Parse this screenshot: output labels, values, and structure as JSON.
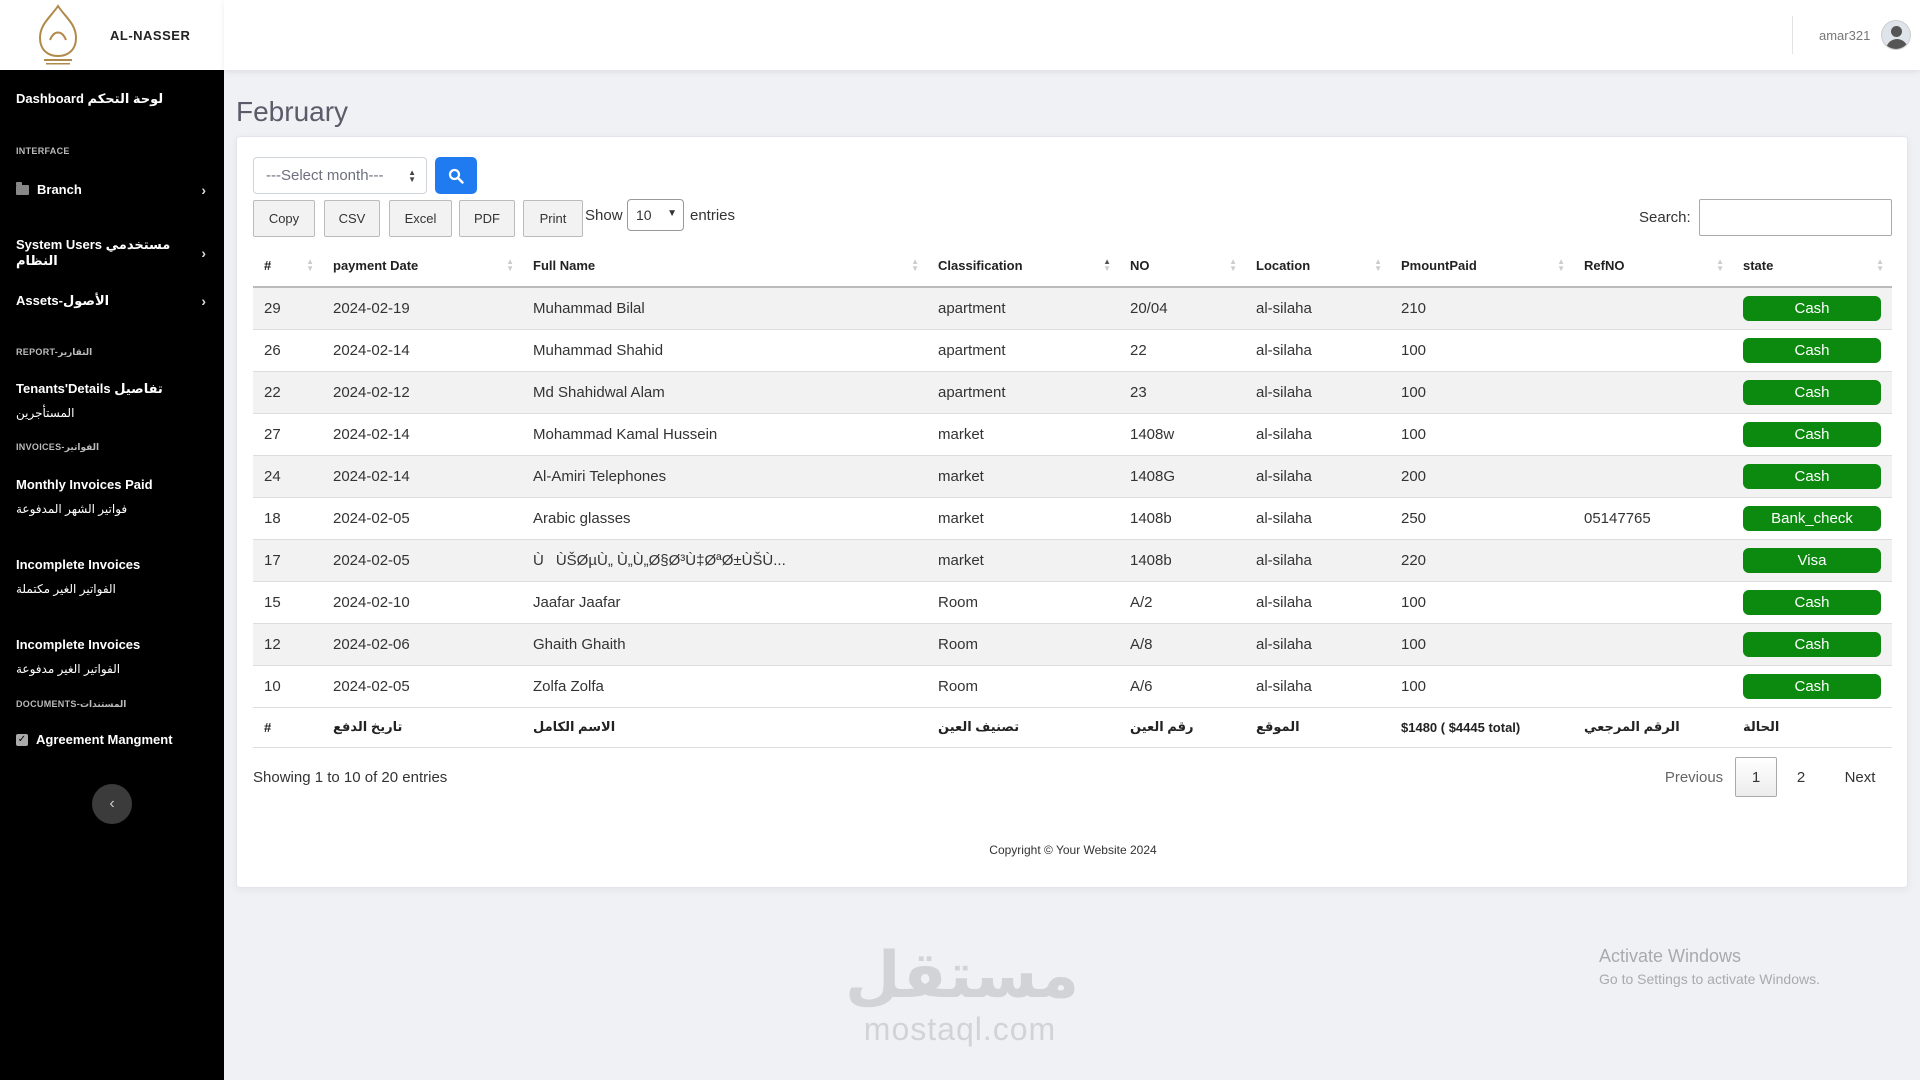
{
  "brand": {
    "name": "AL-NASSER"
  },
  "sidebar": {
    "dashboard": "Dashboard لوحة التحكم",
    "interface_heading": "INTERFACE",
    "branch": "Branch",
    "system_users": "System Users مستخدمي النظام",
    "assets": "Assets-الأصول",
    "report_heading": "REPORT-التقارير",
    "tenants_line1": "Tenants'Details تفاصيل",
    "tenants_line2": "المستأجرين",
    "invoices_heading": "INVOICES-الفواتير",
    "monthly_line1": "Monthly Invoices Paid",
    "monthly_line2": "فواتير الشهر المدفوعة",
    "incomplete1_line1": "Incomplete Invoices",
    "incomplete1_line2": "الفواتير الغير مكتملة",
    "incomplete2_line1": "Incomplete Invoices",
    "incomplete2_line2": "الفواتير الغير مدفوعة",
    "documents_heading": "DOCUMENTS-المستندات",
    "agreement": "Agreement Mangment"
  },
  "topbar": {
    "username": "amar321"
  },
  "page": {
    "title": "February"
  },
  "filter": {
    "month_placeholder": "---Select month---"
  },
  "buttons": {
    "copy": "Copy",
    "csv": "CSV",
    "excel": "Excel",
    "pdf": "PDF",
    "print": "Print"
  },
  "length": {
    "show": "Show",
    "value": "10",
    "entries": "entries"
  },
  "search": {
    "label": "Search:",
    "value": ""
  },
  "table": {
    "headers": [
      "#",
      "payment Date",
      "Full Name",
      "Classification",
      "NO",
      "Location",
      "PmountPaid",
      "RefNO",
      "state"
    ],
    "rows": [
      [
        "29",
        "2024-02-19",
        "Muhammad Bilal",
        "apartment",
        "20/04",
        "al-silaha",
        "210",
        "",
        "Cash"
      ],
      [
        "26",
        "2024-02-14",
        "Muhammad Shahid",
        "apartment",
        "22",
        "al-silaha",
        "100",
        "",
        "Cash"
      ],
      [
        "22",
        "2024-02-12",
        "Md Shahidwal Alam",
        "apartment",
        "23",
        "al-silaha",
        "100",
        "",
        "Cash"
      ],
      [
        "27",
        "2024-02-14",
        "Mohammad Kamal Hussein",
        "market",
        "1408w",
        "al-silaha",
        "100",
        "",
        "Cash"
      ],
      [
        "24",
        "2024-02-14",
        "Al-Amiri Telephones",
        "market",
        "1408G",
        "al-silaha",
        "200",
        "",
        "Cash"
      ],
      [
        "18",
        "2024-02-05",
        "Arabic glasses",
        "market",
        "1408b",
        "al-silaha",
        "250",
        "05147765",
        "Bank_check"
      ],
      [
        "17",
        "2024-02-05",
        "ÙÙŠØµÙ„ Ù„Ù„Ø§Ø³Ù‡ØªØ±ÙŠÙ...",
        "market",
        "1408b",
        "al-silaha",
        "220",
        "",
        "Visa"
      ],
      [
        "15",
        "2024-02-10",
        "Jaafar Jaafar",
        "Room",
        "A/2",
        "al-silaha",
        "100",
        "",
        "Cash"
      ],
      [
        "12",
        "2024-02-06",
        "Ghaith Ghaith",
        "Room",
        "A/8",
        "al-silaha",
        "100",
        "",
        "Cash"
      ],
      [
        "10",
        "2024-02-05",
        "Zolfa Zolfa",
        "Room",
        "A/6",
        "al-silaha",
        "100",
        "",
        "Cash"
      ]
    ],
    "footer": [
      "#",
      "تاريخ الدفع",
      "الاسم الكامل",
      "تصنيف العين",
      "رقم العين",
      "الموقع",
      "$1480 ( $4445 total)",
      "الرقم المرجعي",
      "الحالة"
    ]
  },
  "info": "Showing 1 to 10 of 20 entries",
  "pagination": {
    "previous": "Previous",
    "page1": "1",
    "page2": "2",
    "next": "Next"
  },
  "copyright": "Copyright © Your Website 2024",
  "overlay": {
    "activate_title": "Activate Windows",
    "activate_sub": "Go to Settings to activate Windows.",
    "watermark_ar": "مستقل",
    "watermark_en": "mostaql.com"
  },
  "colors": {
    "accent": "#1f7bef",
    "badge": "#0c8a10",
    "sidebar": "#000000"
  }
}
